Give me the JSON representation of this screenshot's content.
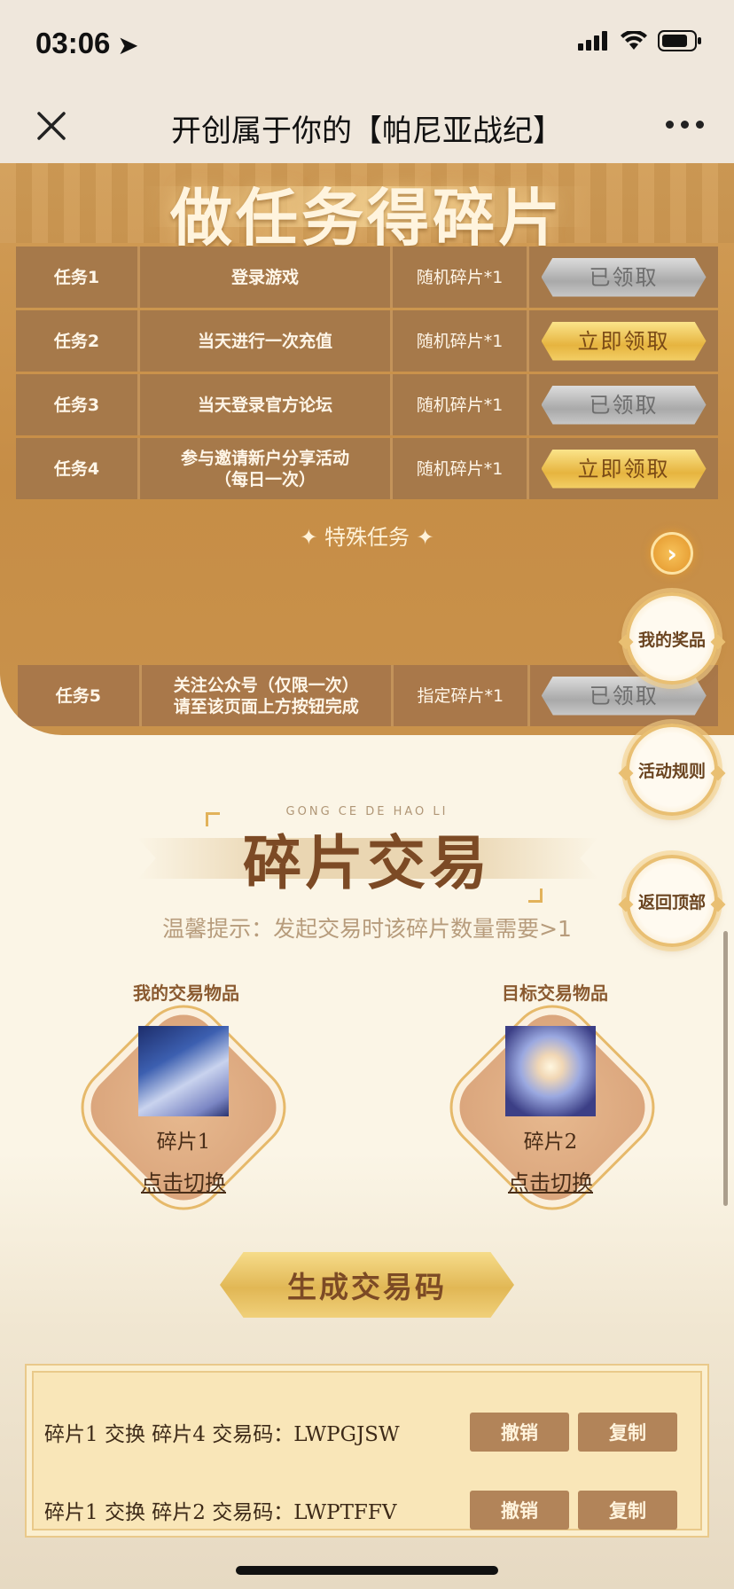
{
  "status_bar": {
    "time": "03:06"
  },
  "nav": {
    "title": "开创属于你的【帕尼亚战纪】"
  },
  "tasks": {
    "heading": "做任务得碎片",
    "rows": [
      {
        "id": "任务1",
        "desc": "登录游戏",
        "reward": "随机碎片*1",
        "action": "已领取",
        "state": "claimed"
      },
      {
        "id": "任务2",
        "desc": "当天进行一次充值",
        "reward": "随机碎片*1",
        "action": "立即领取",
        "state": "available"
      },
      {
        "id": "任务3",
        "desc": "当天登录官方论坛",
        "reward": "随机碎片*1",
        "action": "已领取",
        "state": "claimed"
      },
      {
        "id": "任务4",
        "desc_line1": "参与邀请新户分享活动",
        "desc_line2": "（每日一次）",
        "reward": "随机碎片*1",
        "action": "立即领取",
        "state": "available"
      }
    ],
    "special_title": "✦ 特殊任务 ✦",
    "special": {
      "id": "任务5",
      "desc_line1": "关注公众号（仅限一次）",
      "desc_line2": "请至该页面上方按钮完成",
      "reward": "指定碎片*1",
      "action": "已领取",
      "state": "claimed"
    }
  },
  "float_buttons": {
    "prizes": "我的奖品",
    "rules": "活动规则",
    "top": "返回顶部"
  },
  "trade": {
    "subtitle": "GONG CE DE HAO LI",
    "title": "碎片交易",
    "tip": "温馨提示：发起交易时该碎片数量需要>1",
    "my_item": {
      "label": "我的交易物品",
      "name": "碎片1",
      "switch": "点击切换"
    },
    "target_item": {
      "label": "目标交易物品",
      "name": "碎片2",
      "switch": "点击切换"
    },
    "generate_label": "生成交易码"
  },
  "codes": [
    {
      "text": "碎片1 交换 碎片4 交易码：LWPGJSW",
      "revoke": "撤销",
      "copy": "复制"
    },
    {
      "text": "碎片1 交换 碎片2 交易码：LWPTFFV",
      "revoke": "撤销",
      "copy": "复制"
    }
  ]
}
